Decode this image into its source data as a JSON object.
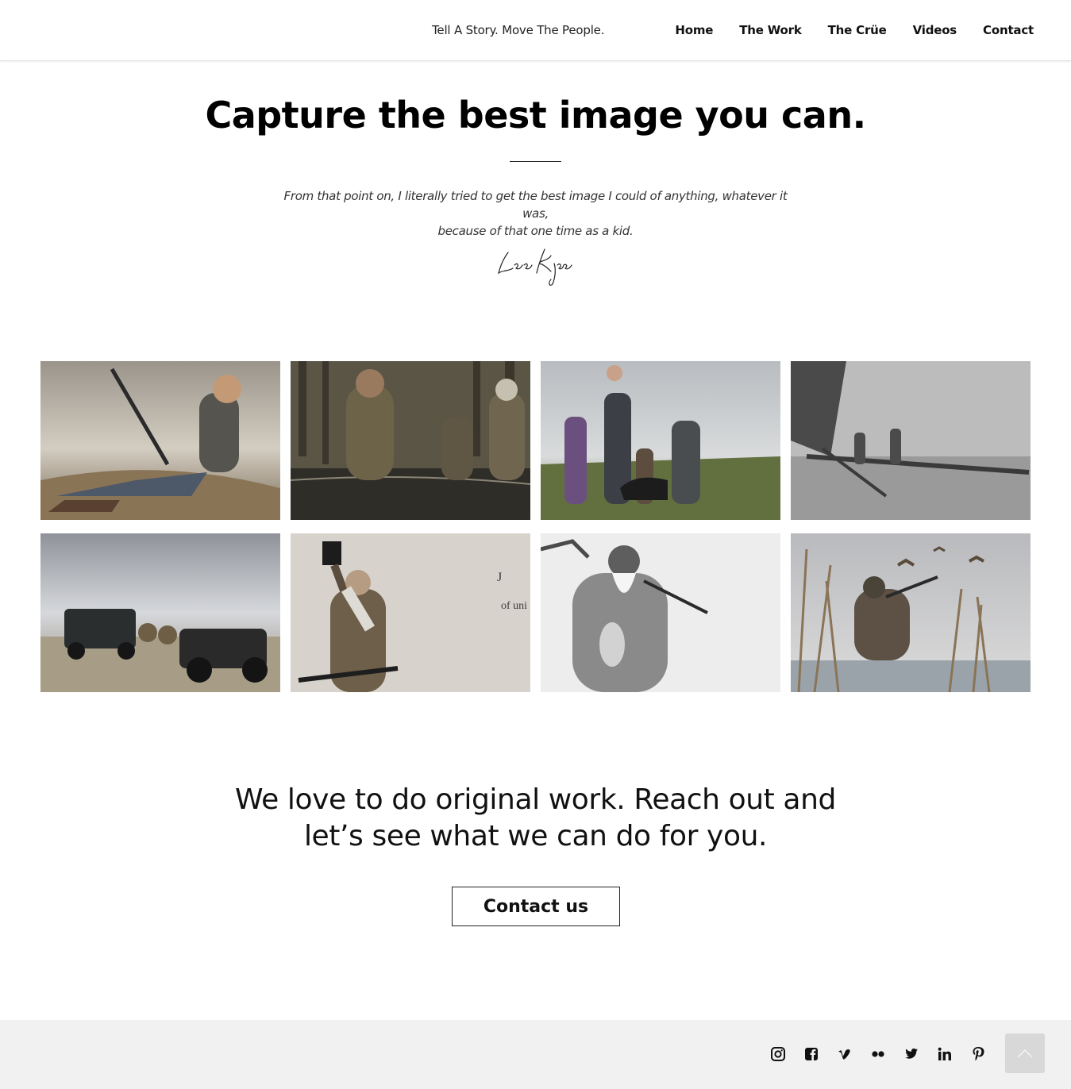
{
  "header": {
    "tagline": "Tell A Story. Move The People.",
    "nav": [
      "Home",
      "The Work",
      "The Crüe",
      "Videos",
      "Contact"
    ]
  },
  "hero": {
    "title": "Capture the best image you can.",
    "quote_line1": "From that point on, I literally tried to get the best image I could of anything, whatever it was,",
    "quote_line2": "because of that one time as a kid.",
    "signature": "Lee Kjos"
  },
  "gallery": {
    "images": [
      "woman-with-bow-on-hay-photo",
      "duck-hunters-in-swamp-photo",
      "family-walking-with-dog-photo",
      "hunters-on-fallen-tree-photo",
      "utility-vehicles-on-field-photo",
      "man-raising-book-photo",
      "bearded-man-with-ducks-photo",
      "hunter-shooting-ducks-photo"
    ]
  },
  "cta": {
    "line1": "We love to do original work. Reach out and",
    "line2": "let’s see what we can do for you.",
    "button": "Contact us"
  },
  "footer": {
    "social_icons": [
      "instagram-icon",
      "facebook-icon",
      "vimeo-icon",
      "flickr-icon",
      "twitter-icon",
      "linkedin-icon",
      "pinterest-icon"
    ],
    "scroll_top_icon": "chevron-up-icon"
  }
}
